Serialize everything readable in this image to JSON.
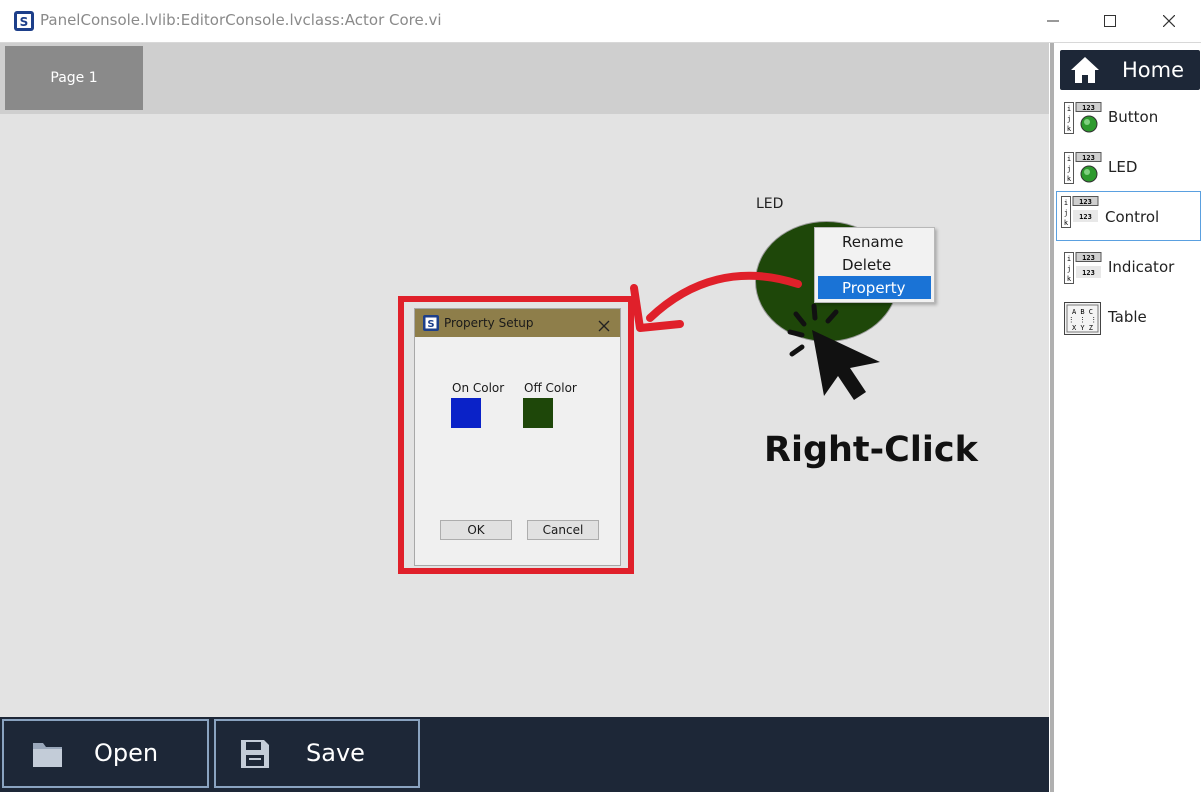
{
  "window": {
    "title": "PanelConsole.lvlib:EditorConsole.lvclass:Actor Core.vi",
    "controls": [
      "minimize-icon",
      "maximize-icon",
      "close-icon"
    ]
  },
  "tabs": [
    {
      "label": "Page 1",
      "selected": true
    }
  ],
  "canvas": {
    "led": {
      "label": "LED",
      "color": "#1e4709"
    },
    "context_menu": {
      "items": [
        {
          "label": "Rename",
          "highlighted": false
        },
        {
          "label": "Delete",
          "highlighted": false
        },
        {
          "label": "Property",
          "highlighted": true
        }
      ]
    },
    "annotation": {
      "text": "Right-Click",
      "arrow_color": "#e0202a",
      "cursor_icon": "hand-click-cursor-icon"
    }
  },
  "dialog": {
    "title": "Property Setup",
    "on_color": {
      "label": "On Color",
      "color": "#0a22c8"
    },
    "off_color": {
      "label": "Off Color",
      "color": "#1e4709"
    },
    "ok_label": "OK",
    "cancel_label": "Cancel"
  },
  "bottom_bar": {
    "open_label": "Open",
    "save_label": "Save"
  },
  "sidebar": {
    "home_label": "Home",
    "items": [
      {
        "label": "Button",
        "icon": "button-control-icon",
        "selected": false
      },
      {
        "label": "LED",
        "icon": "led-control-icon",
        "selected": false
      },
      {
        "label": "Control",
        "icon": "numeric-control-icon",
        "selected": true
      },
      {
        "label": "Indicator",
        "icon": "numeric-indicator-icon",
        "selected": false
      },
      {
        "label": "Table",
        "icon": "table-icon",
        "selected": false
      }
    ]
  },
  "colors": {
    "dark_navy": "#1d2737",
    "highlight_red": "#e0202a",
    "menu_highlight": "#1a73d6"
  }
}
